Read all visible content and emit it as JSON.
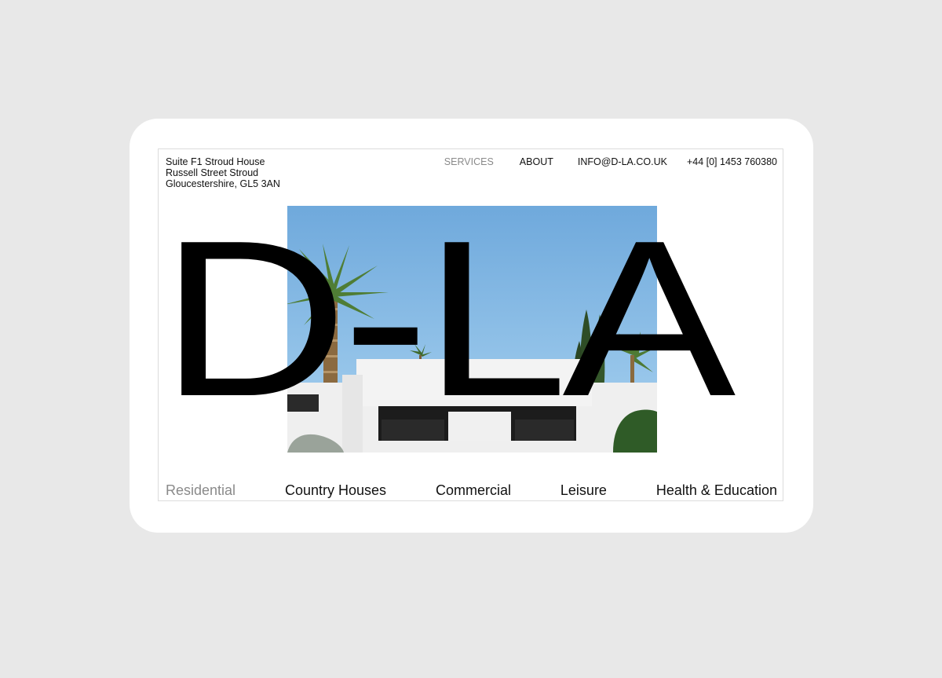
{
  "address": {
    "line1": "Suite F1 Stroud House",
    "line2": "Russell Street Stroud",
    "line3": "Gloucestershire, GL5 3AN"
  },
  "nav": {
    "services": "SERVICES",
    "about": "ABOUT",
    "email": "INFO@D-LA.CO.UK",
    "phone": "+44 [0] 1453 760380"
  },
  "logo": "D-LA",
  "categories": [
    {
      "label": "Residential",
      "active": true
    },
    {
      "label": "Country Houses",
      "active": false
    },
    {
      "label": "Commercial",
      "active": false
    },
    {
      "label": "Leisure",
      "active": false
    },
    {
      "label": "Health & Education",
      "active": false
    }
  ],
  "colors": {
    "background": "#e8e8e8",
    "device": "#ffffff",
    "text": "#111111",
    "muted": "#8a8a8a",
    "sky": "#7fb6e3"
  }
}
